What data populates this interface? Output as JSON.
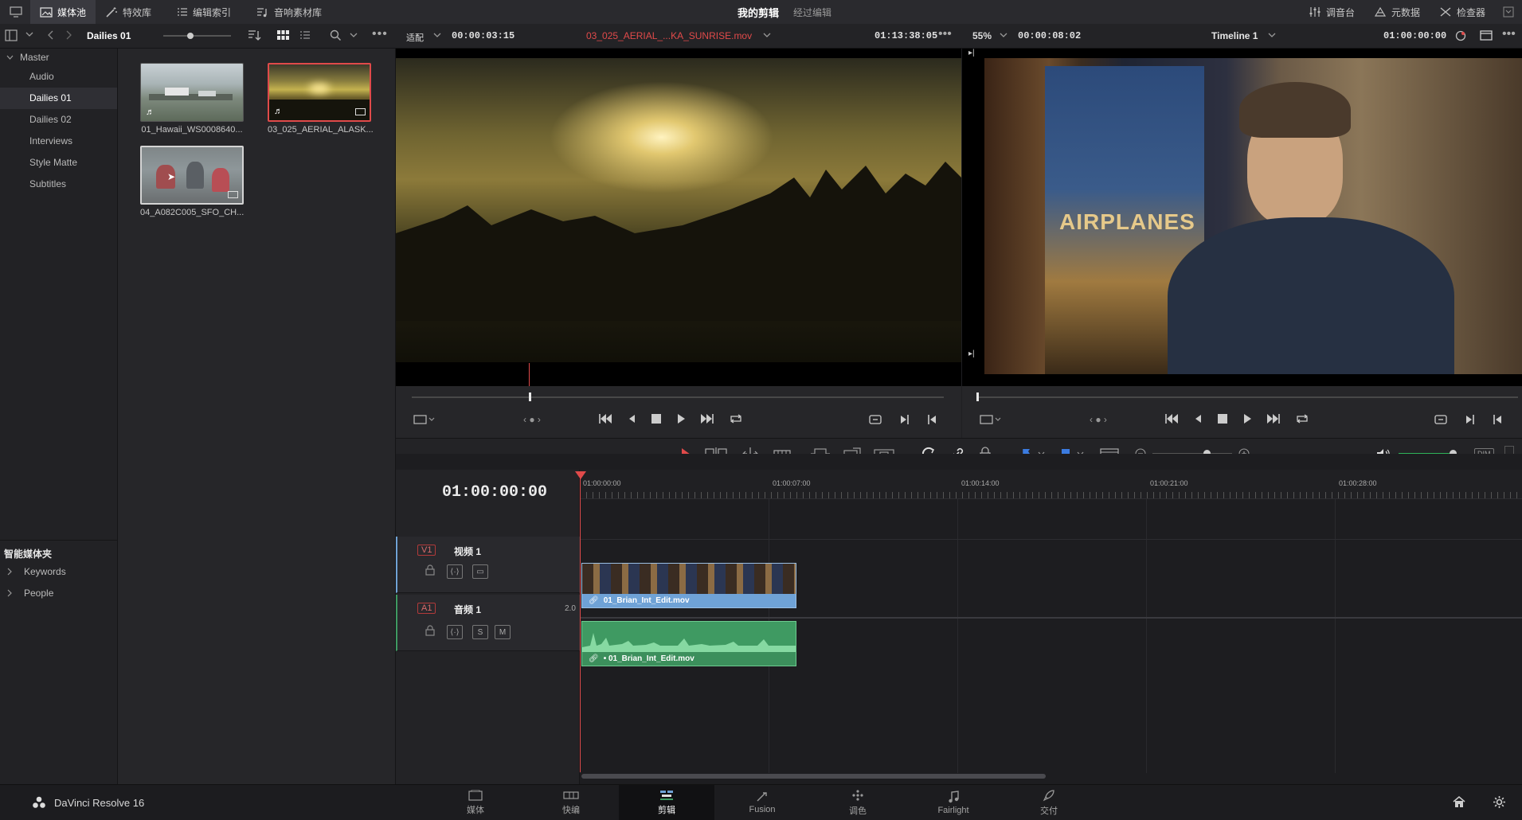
{
  "topbar": {
    "tabs": [
      {
        "label": "媒体池",
        "active": true
      },
      {
        "label": "特效库"
      },
      {
        "label": "编辑索引"
      },
      {
        "label": "音响素材库"
      }
    ],
    "project_title": "我的剪辑",
    "project_status": "经过编辑",
    "right_tabs": [
      {
        "label": "调音台"
      },
      {
        "label": "元数据"
      },
      {
        "label": "检查器"
      }
    ]
  },
  "subbar": {
    "bin_name": "Dailies 01",
    "fit_label": "适配",
    "source_duration": "00:00:03:15",
    "source_clip_name": "03_025_AERIAL_...KA_SUNRISE.mov",
    "source_timecode": "01:13:38:05",
    "zoom": "55%",
    "program_duration": "00:00:08:02",
    "timeline_name": "Timeline 1",
    "program_timecode": "01:00:00:00"
  },
  "bins": {
    "root": "Master",
    "items": [
      "Audio",
      "Dailies 01",
      "Dailies 02",
      "Interviews",
      "Style Matte",
      "Subtitles"
    ],
    "selected_index": 1,
    "smart_title": "智能媒体夹",
    "smart_items": [
      "Keywords",
      "People"
    ]
  },
  "clips": [
    {
      "name": "01_Hawaii_WS0008640..."
    },
    {
      "name": "03_025_AERIAL_ALASK..."
    },
    {
      "name": "04_A082C005_SFO_CH..."
    }
  ],
  "timeline": {
    "timecode": "01:00:00:00",
    "ruler": [
      "01:00:00:00",
      "01:00:07:00",
      "01:00:14:00",
      "01:00:21:00",
      "01:00:28:00"
    ],
    "video_track": {
      "id": "V1",
      "name": "视频 1",
      "clip": "01_Brian_Int_Edit.mov"
    },
    "audio_track": {
      "id": "A1",
      "name": "音频 1",
      "channels": "2.0",
      "clip": "• 01_Brian_Int_Edit.mov",
      "solo": "S",
      "mute": "M"
    },
    "dim_label": "DIM"
  },
  "bottombar": {
    "app_name": "DaVinci Resolve 16",
    "pages": [
      {
        "label": "媒体"
      },
      {
        "label": "快编"
      },
      {
        "label": "剪辑",
        "active": true
      },
      {
        "label": "Fusion"
      },
      {
        "label": "调色"
      },
      {
        "label": "Fairlight"
      },
      {
        "label": "交付"
      }
    ]
  },
  "colors": {
    "accent_red": "#e04a4a",
    "video_clip_blue": "#6fa2d6",
    "audio_clip_green": "#3f9a62"
  }
}
